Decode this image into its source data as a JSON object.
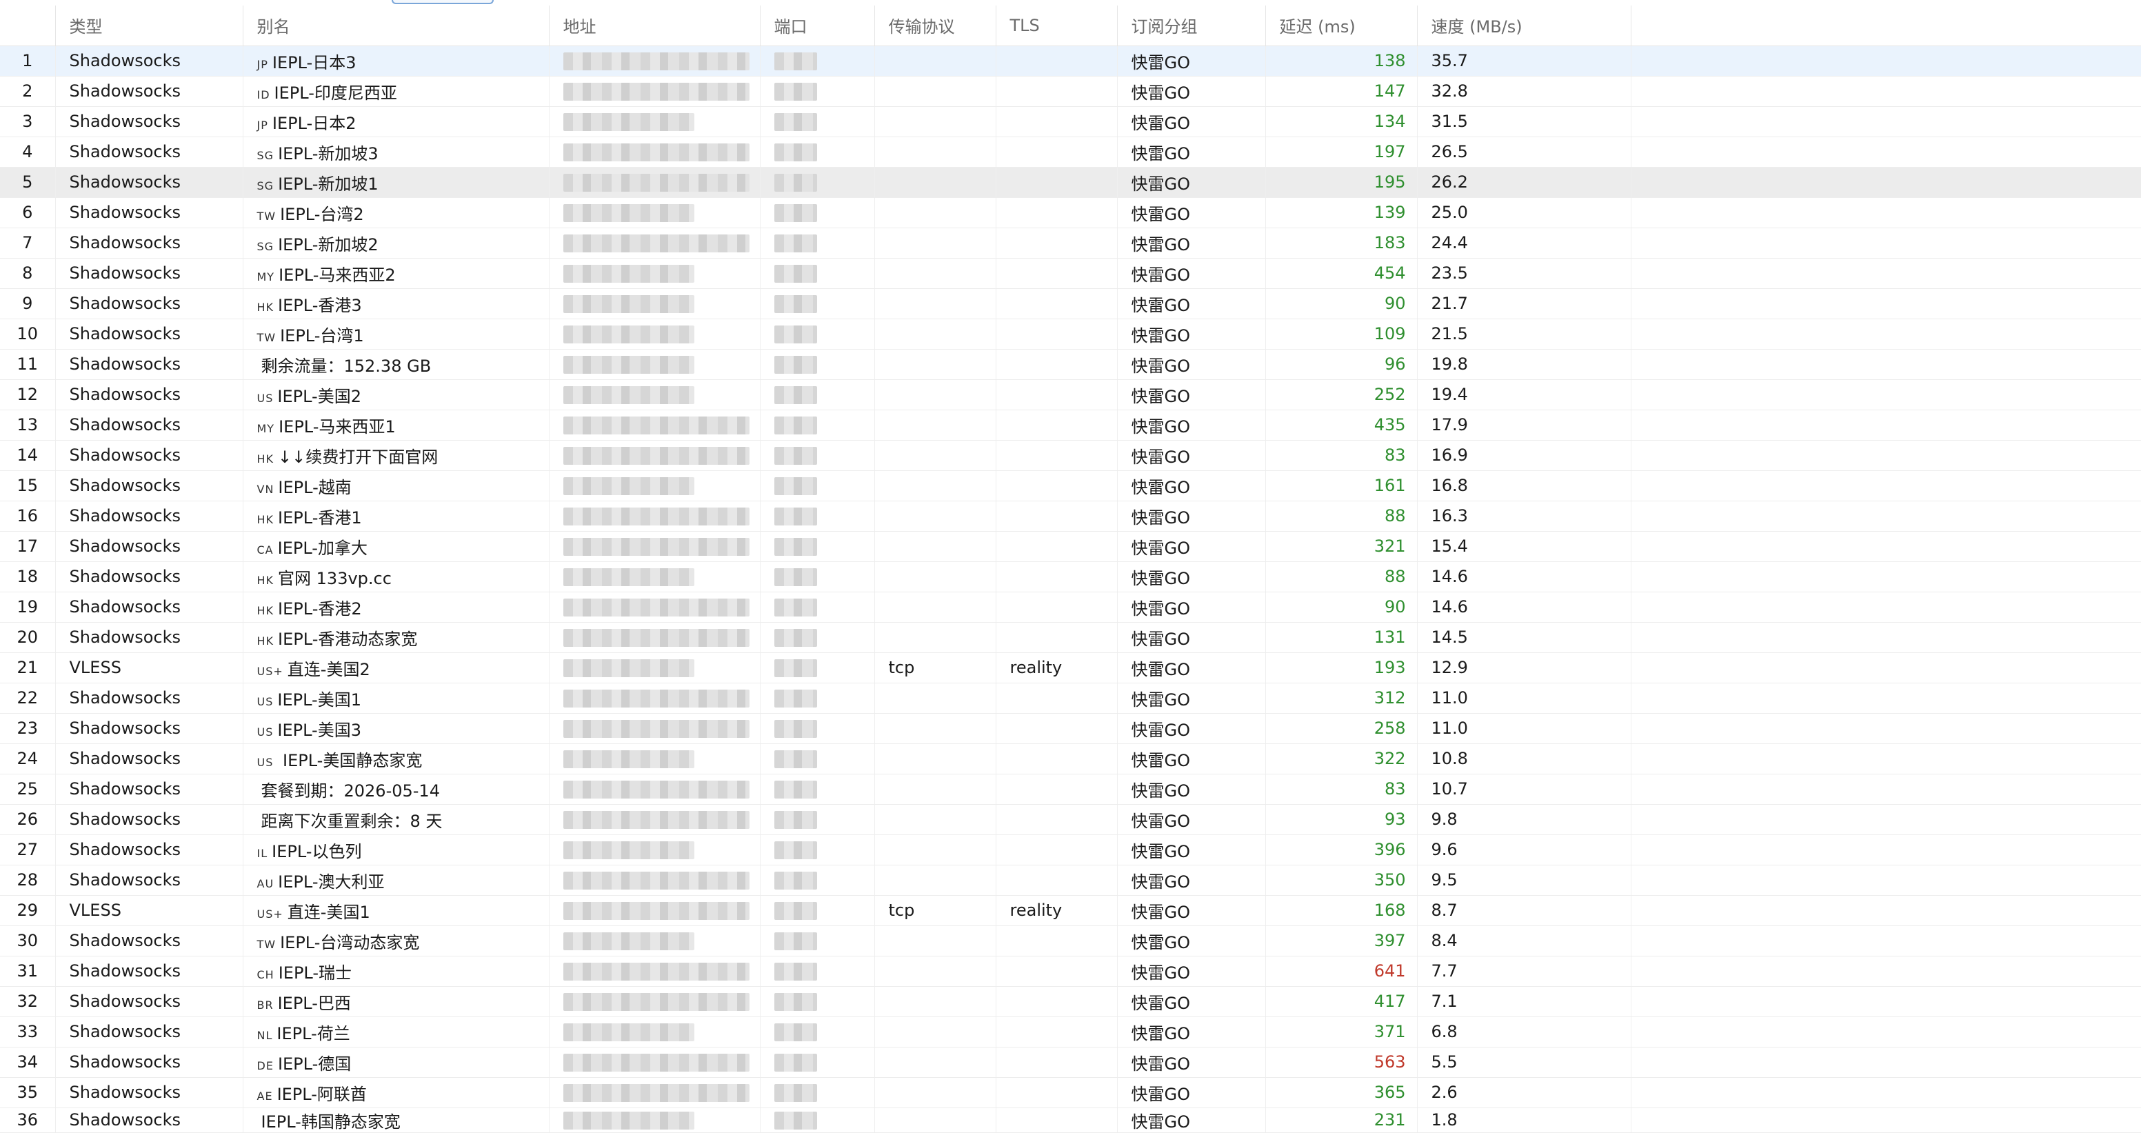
{
  "columns": [
    "类型",
    "别名",
    "地址",
    "端口",
    "传输协议",
    "TLS",
    "订阅分组",
    "延迟 (ms)",
    "速度 (MB/s)"
  ],
  "rows": [
    {
      "n": "1",
      "type": "Shadowsocks",
      "cc": "JP",
      "alias": "IEPL-日本3",
      "transport": "",
      "tls": "",
      "group": "快雷GO",
      "latency": "138",
      "speed": "35.7",
      "lat_color": "green"
    },
    {
      "n": "2",
      "type": "Shadowsocks",
      "cc": "ID",
      "alias": "IEPL-印度尼西亚",
      "transport": "",
      "tls": "",
      "group": "快雷GO",
      "latency": "147",
      "speed": "32.8",
      "lat_color": "green"
    },
    {
      "n": "3",
      "type": "Shadowsocks",
      "cc": "JP",
      "alias": "IEPL-日本2",
      "transport": "",
      "tls": "",
      "group": "快雷GO",
      "latency": "134",
      "speed": "31.5",
      "lat_color": "green"
    },
    {
      "n": "4",
      "type": "Shadowsocks",
      "cc": "SG",
      "alias": "IEPL-新加坡3",
      "transport": "",
      "tls": "",
      "group": "快雷GO",
      "latency": "197",
      "speed": "26.5",
      "lat_color": "green"
    },
    {
      "n": "5",
      "type": "Shadowsocks",
      "cc": "SG",
      "alias": "IEPL-新加坡1",
      "transport": "",
      "tls": "",
      "group": "快雷GO",
      "latency": "195",
      "speed": "26.2",
      "lat_color": "green"
    },
    {
      "n": "6",
      "type": "Shadowsocks",
      "cc": "TW",
      "alias": "IEPL-台湾2",
      "transport": "",
      "tls": "",
      "group": "快雷GO",
      "latency": "139",
      "speed": "25.0",
      "lat_color": "green"
    },
    {
      "n": "7",
      "type": "Shadowsocks",
      "cc": "SG",
      "alias": "IEPL-新加坡2",
      "transport": "",
      "tls": "",
      "group": "快雷GO",
      "latency": "183",
      "speed": "24.4",
      "lat_color": "green"
    },
    {
      "n": "8",
      "type": "Shadowsocks",
      "cc": "MY",
      "alias": "IEPL-马来西亚2",
      "transport": "",
      "tls": "",
      "group": "快雷GO",
      "latency": "454",
      "speed": "23.5",
      "lat_color": "green"
    },
    {
      "n": "9",
      "type": "Shadowsocks",
      "cc": "HK",
      "alias": "IEPL-香港3",
      "transport": "",
      "tls": "",
      "group": "快雷GO",
      "latency": "90",
      "speed": "21.7",
      "lat_color": "green"
    },
    {
      "n": "10",
      "type": "Shadowsocks",
      "cc": "TW",
      "alias": "IEPL-台湾1",
      "transport": "",
      "tls": "",
      "group": "快雷GO",
      "latency": "109",
      "speed": "21.5",
      "lat_color": "green"
    },
    {
      "n": "11",
      "type": "Shadowsocks",
      "cc": "",
      "alias": "剩余流量：152.38 GB",
      "transport": "",
      "tls": "",
      "group": "快雷GO",
      "latency": "96",
      "speed": "19.8",
      "lat_color": "green"
    },
    {
      "n": "12",
      "type": "Shadowsocks",
      "cc": "US",
      "alias": "IEPL-美国2",
      "transport": "",
      "tls": "",
      "group": "快雷GO",
      "latency": "252",
      "speed": "19.4",
      "lat_color": "green"
    },
    {
      "n": "13",
      "type": "Shadowsocks",
      "cc": "MY",
      "alias": "IEPL-马来西亚1",
      "transport": "",
      "tls": "",
      "group": "快雷GO",
      "latency": "435",
      "speed": "17.9",
      "lat_color": "green"
    },
    {
      "n": "14",
      "type": "Shadowsocks",
      "cc": "HK",
      "alias": "↓↓续费打开下面官网",
      "transport": "",
      "tls": "",
      "group": "快雷GO",
      "latency": "83",
      "speed": "16.9",
      "lat_color": "green"
    },
    {
      "n": "15",
      "type": "Shadowsocks",
      "cc": "VN",
      "alias": "IEPL-越南",
      "transport": "",
      "tls": "",
      "group": "快雷GO",
      "latency": "161",
      "speed": "16.8",
      "lat_color": "green"
    },
    {
      "n": "16",
      "type": "Shadowsocks",
      "cc": "HK",
      "alias": "IEPL-香港1",
      "transport": "",
      "tls": "",
      "group": "快雷GO",
      "latency": "88",
      "speed": "16.3",
      "lat_color": "green"
    },
    {
      "n": "17",
      "type": "Shadowsocks",
      "cc": "CA",
      "alias": "IEPL-加拿大",
      "transport": "",
      "tls": "",
      "group": "快雷GO",
      "latency": "321",
      "speed": "15.4",
      "lat_color": "green"
    },
    {
      "n": "18",
      "type": "Shadowsocks",
      "cc": "HK",
      "alias": "官网 133vp.cc",
      "transport": "",
      "tls": "",
      "group": "快雷GO",
      "latency": "88",
      "speed": "14.6",
      "lat_color": "green"
    },
    {
      "n": "19",
      "type": "Shadowsocks",
      "cc": "HK",
      "alias": "IEPL-香港2",
      "transport": "",
      "tls": "",
      "group": "快雷GO",
      "latency": "90",
      "speed": "14.6",
      "lat_color": "green"
    },
    {
      "n": "20",
      "type": "Shadowsocks",
      "cc": "HK",
      "alias": "IEPL-香港动态家宽",
      "transport": "",
      "tls": "",
      "group": "快雷GO",
      "latency": "131",
      "speed": "14.5",
      "lat_color": "green"
    },
    {
      "n": "21",
      "type": "VLESS",
      "cc": "US+",
      "alias": "直连-美国2",
      "transport": "tcp",
      "tls": "reality",
      "group": "快雷GO",
      "latency": "193",
      "speed": "12.9",
      "lat_color": "green"
    },
    {
      "n": "22",
      "type": "Shadowsocks",
      "cc": "US",
      "alias": "IEPL-美国1",
      "transport": "",
      "tls": "",
      "group": "快雷GO",
      "latency": "312",
      "speed": "11.0",
      "lat_color": "green"
    },
    {
      "n": "23",
      "type": "Shadowsocks",
      "cc": "US",
      "alias": "IEPL-美国3",
      "transport": "",
      "tls": "",
      "group": "快雷GO",
      "latency": "258",
      "speed": "11.0",
      "lat_color": "green"
    },
    {
      "n": "24",
      "type": "Shadowsocks",
      "cc": "US",
      "alias": " IEPL-美国静态家宽",
      "transport": "",
      "tls": "",
      "group": "快雷GO",
      "latency": "322",
      "speed": "10.8",
      "lat_color": "green"
    },
    {
      "n": "25",
      "type": "Shadowsocks",
      "cc": "",
      "alias": "套餐到期：2026-05-14",
      "transport": "",
      "tls": "",
      "group": "快雷GO",
      "latency": "83",
      "speed": "10.7",
      "lat_color": "green"
    },
    {
      "n": "26",
      "type": "Shadowsocks",
      "cc": "",
      "alias": "距离下次重置剩余：8 天",
      "transport": "",
      "tls": "",
      "group": "快雷GO",
      "latency": "93",
      "speed": "9.8",
      "lat_color": "green"
    },
    {
      "n": "27",
      "type": "Shadowsocks",
      "cc": "IL",
      "alias": "IEPL-以色列",
      "transport": "",
      "tls": "",
      "group": "快雷GO",
      "latency": "396",
      "speed": "9.6",
      "lat_color": "green"
    },
    {
      "n": "28",
      "type": "Shadowsocks",
      "cc": "AU",
      "alias": "IEPL-澳大利亚",
      "transport": "",
      "tls": "",
      "group": "快雷GO",
      "latency": "350",
      "speed": "9.5",
      "lat_color": "green"
    },
    {
      "n": "29",
      "type": "VLESS",
      "cc": "US+",
      "alias": "直连-美国1",
      "transport": "tcp",
      "tls": "reality",
      "group": "快雷GO",
      "latency": "168",
      "speed": "8.7",
      "lat_color": "green"
    },
    {
      "n": "30",
      "type": "Shadowsocks",
      "cc": "TW",
      "alias": "IEPL-台湾动态家宽",
      "transport": "",
      "tls": "",
      "group": "快雷GO",
      "latency": "397",
      "speed": "8.4",
      "lat_color": "green"
    },
    {
      "n": "31",
      "type": "Shadowsocks",
      "cc": "CH",
      "alias": "IEPL-瑞士",
      "transport": "",
      "tls": "",
      "group": "快雷GO",
      "latency": "641",
      "speed": "7.7",
      "lat_color": "red"
    },
    {
      "n": "32",
      "type": "Shadowsocks",
      "cc": "BR",
      "alias": "IEPL-巴西",
      "transport": "",
      "tls": "",
      "group": "快雷GO",
      "latency": "417",
      "speed": "7.1",
      "lat_color": "green"
    },
    {
      "n": "33",
      "type": "Shadowsocks",
      "cc": "NL",
      "alias": "IEPL-荷兰",
      "transport": "",
      "tls": "",
      "group": "快雷GO",
      "latency": "371",
      "speed": "6.8",
      "lat_color": "green"
    },
    {
      "n": "34",
      "type": "Shadowsocks",
      "cc": "DE",
      "alias": "IEPL-德国",
      "transport": "",
      "tls": "",
      "group": "快雷GO",
      "latency": "563",
      "speed": "5.5",
      "lat_color": "red"
    },
    {
      "n": "35",
      "type": "Shadowsocks",
      "cc": "AE",
      "alias": "IEPL-阿联酋",
      "transport": "",
      "tls": "",
      "group": "快雷GO",
      "latency": "365",
      "speed": "2.6",
      "lat_color": "green"
    },
    {
      "n": "36",
      "type": "Shadowsocks",
      "cc": "",
      "alias": "IEPL-韩国静态家宽",
      "transport": "",
      "tls": "",
      "group": "快雷GO",
      "latency": "231",
      "speed": "1.8",
      "lat_color": "green"
    }
  ],
  "selected_row": "1",
  "hover_row": "5",
  "colors": {
    "latency_good": "#2f8f2f",
    "latency_bad": "#c0392b",
    "selection": "#eaf3fd"
  }
}
